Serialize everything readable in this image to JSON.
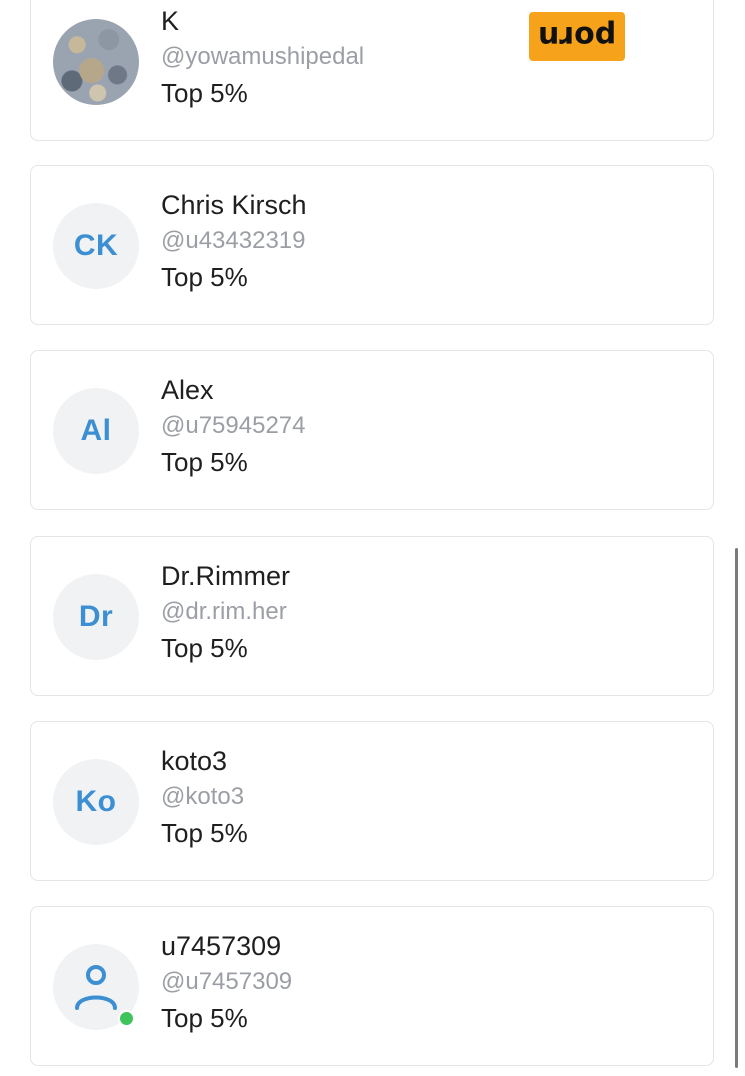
{
  "rank_label": "Top 5%",
  "users": [
    {
      "name": "K",
      "handle": "@yowamushipedal",
      "rank": "Top 5%",
      "avatar": "photo",
      "badge": "porn"
    },
    {
      "name": "Chris Kirsch",
      "handle": "@u43432319",
      "rank": "Top 5%",
      "initials": "CK"
    },
    {
      "name": "Alex",
      "handle": "@u75945274",
      "rank": "Top 5%",
      "initials": "Al"
    },
    {
      "name": "Dr.Rimmer",
      "handle": "@dr.rim.her",
      "rank": "Top 5%",
      "initials": "Dr"
    },
    {
      "name": "koto3",
      "handle": "@koto3",
      "rank": "Top 5%",
      "initials": "Ko"
    },
    {
      "name": "u7457309",
      "handle": "@u7457309",
      "rank": "Top 5%",
      "avatar": "user-icon",
      "status": "online"
    }
  ],
  "colors": {
    "initials": "#3d8fd3",
    "avatar_bg": "#f0f2f4",
    "card_border": "#e3e5e8",
    "badge_bg": "#f7a21b",
    "online": "#3ec45b"
  }
}
